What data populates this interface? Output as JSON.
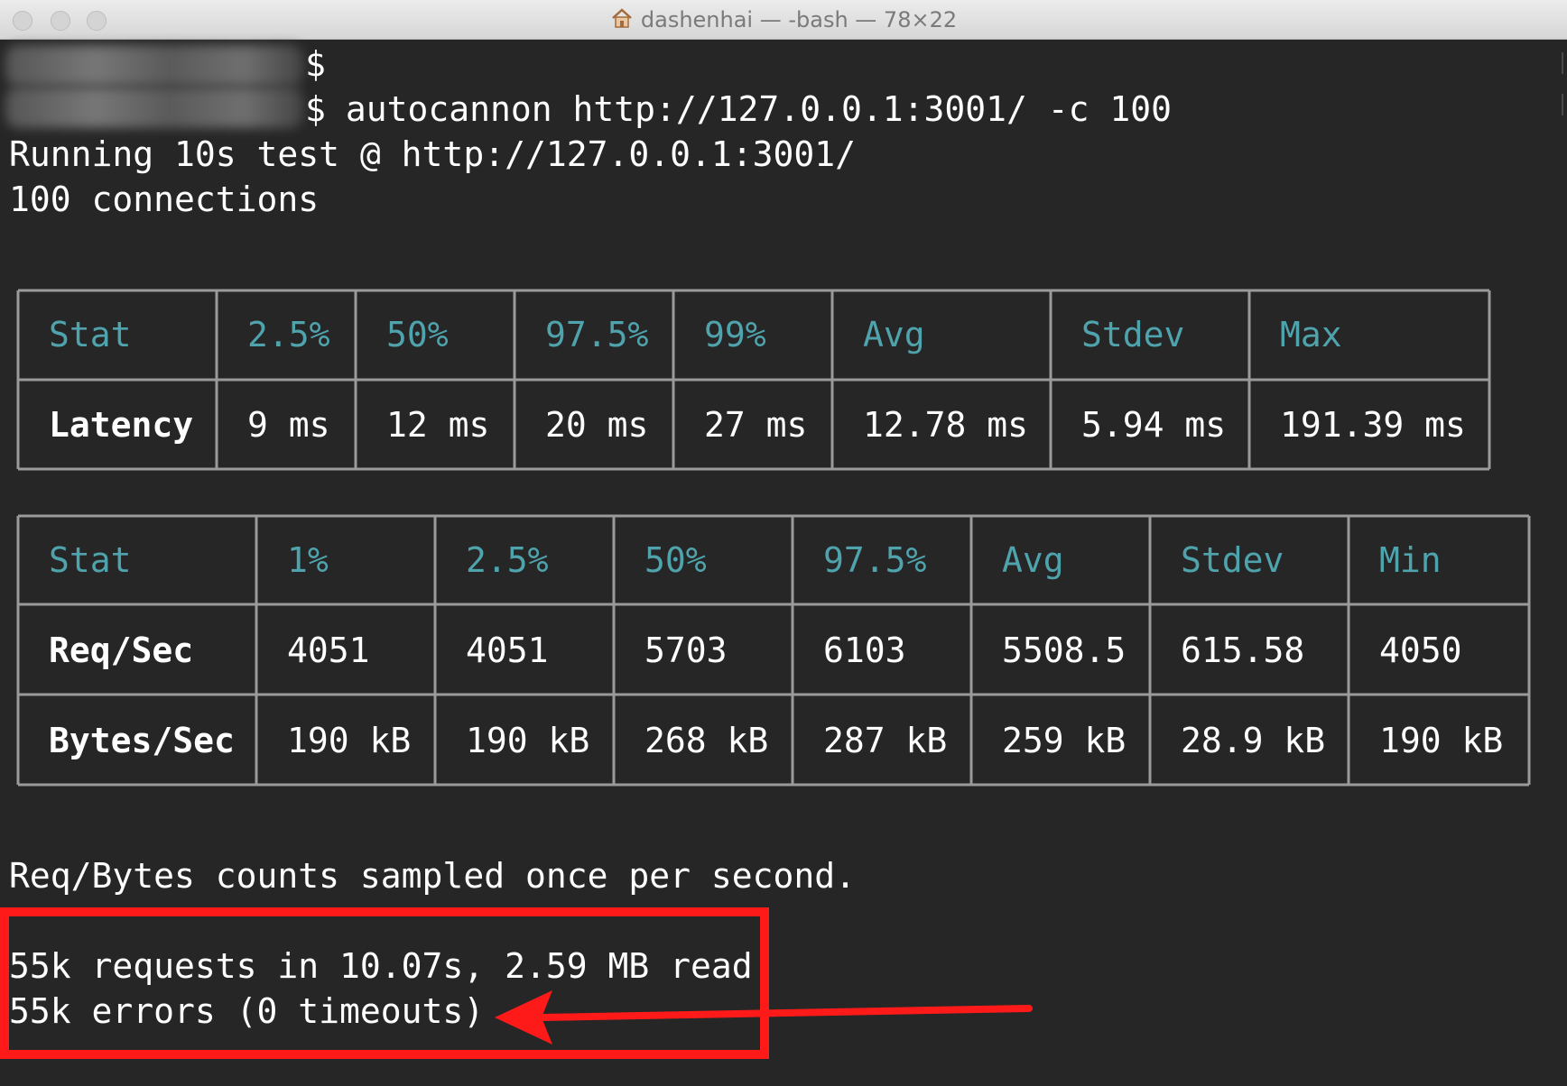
{
  "window": {
    "title": "dashenhai — -bash — 78×22",
    "home_icon": "house-icon"
  },
  "terminal": {
    "prompt_symbol": "$",
    "command": " autocannon http://127.0.0.1:3001/ -c 100",
    "running_line": "Running 10s test @ http://127.0.0.1:3001/",
    "connections_line": "100 connections",
    "sampled_note": "Req/Bytes counts sampled once per second.",
    "summary_requests": "55k requests in 10.07s, 2.59 MB read",
    "summary_errors": "55k errors (0 timeouts)"
  },
  "latency_table": {
    "headers": [
      "Stat",
      "2.5%",
      "50%",
      "97.5%",
      "99%",
      "Avg",
      "Stdev",
      "Max"
    ],
    "rows": [
      [
        "Latency",
        "9 ms",
        "12 ms",
        "20 ms",
        "27 ms",
        "12.78 ms",
        "5.94 ms",
        "191.39 ms"
      ]
    ]
  },
  "throughput_table": {
    "headers": [
      "Stat",
      "1%",
      "2.5%",
      "50%",
      "97.5%",
      "Avg",
      "Stdev",
      "Min"
    ],
    "rows": [
      [
        "Req/Sec",
        "4051",
        "4051",
        "5703",
        "6103",
        "5508.5",
        "615.58",
        "4050"
      ],
      [
        "Bytes/Sec",
        "190 kB",
        "190 kB",
        "268 kB",
        "287 kB",
        "259 kB",
        "28.9 kB",
        "190 kB"
      ]
    ]
  },
  "colors": {
    "background": "#262626",
    "header_text": "#4fa3ad",
    "table_border": "#9a9a9a",
    "annotation": "#ff1a1a"
  }
}
